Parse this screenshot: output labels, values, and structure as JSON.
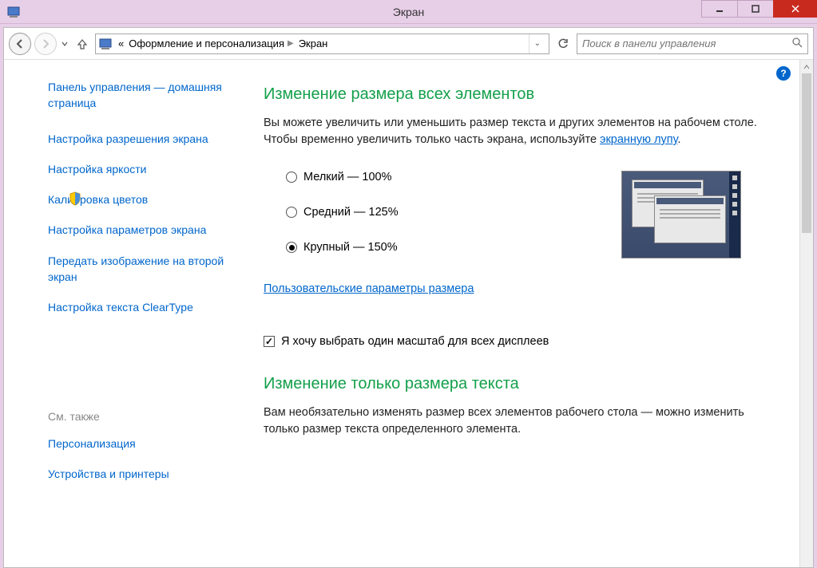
{
  "window": {
    "title": "Экран"
  },
  "breadcrumb": {
    "ellipsis": "«",
    "parent": "Оформление и персонализация",
    "current": "Экран"
  },
  "search": {
    "placeholder": "Поиск в панели управления"
  },
  "sidebar": {
    "home": "Панель управления — домашняя страница",
    "links": [
      "Настройка разрешения экрана",
      "Настройка яркости",
      "Калибровка цветов",
      "Настройка параметров экрана",
      "Передать изображение на второй экран",
      "Настройка текста ClearType"
    ],
    "see_also_header": "См. также",
    "see_also": [
      "Персонализация",
      "Устройства и принтеры"
    ]
  },
  "main": {
    "heading1": "Изменение размера всех элементов",
    "desc1_a": "Вы можете увеличить или уменьшить размер текста и других элементов на рабочем столе. Чтобы временно увеличить только часть экрана, используйте ",
    "desc1_link": "экранную лупу",
    "desc1_b": ".",
    "radio_small": "Мелкий — 100%",
    "radio_medium": "Средний — 125%",
    "radio_large": "Крупный — 150%",
    "custom_link": "Пользовательские параметры размера",
    "checkbox_label": "Я хочу выбрать один масштаб для всех дисплеев",
    "heading2": "Изменение только размера текста",
    "desc2": "Вам необязательно изменять размер всех элементов рабочего стола — можно изменить только размер текста определенного элемента."
  }
}
